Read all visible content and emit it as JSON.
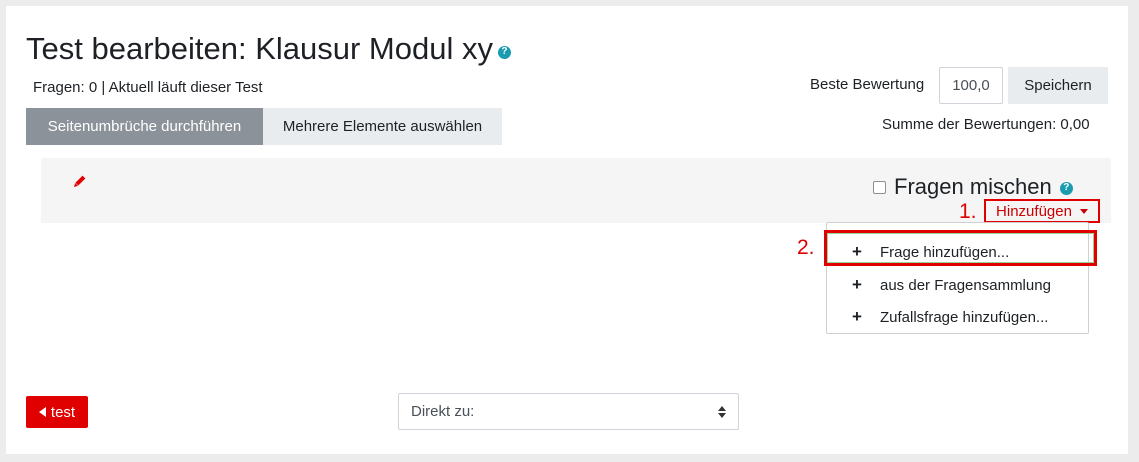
{
  "header": {
    "title": "Test bearbeiten: Klausur Modul xy",
    "help_icon": "?",
    "status": "Fragen: 0 | Aktuell läuft dieser Test"
  },
  "toolbar": {
    "repaginate_label": "Seitenumbrüche durchführen",
    "select_multiple_label": "Mehrere Elemente auswählen"
  },
  "grading": {
    "max_grade_label": "Beste Bewertung",
    "max_grade_value": "100,0",
    "save_label": "Speichern",
    "total_label": "Summe der Bewertungen: 0,00"
  },
  "section": {
    "edit_icon": "pencil-icon",
    "shuffle_label": "Fragen mischen",
    "shuffle_checked": false,
    "help_icon": "?"
  },
  "add_menu": {
    "step1": "1.",
    "step2": "2.",
    "toggle_label": "Hinzufügen",
    "items": [
      {
        "icon": "+",
        "label": "Frage hinzufügen..."
      },
      {
        "icon": "+",
        "label": "aus der Fragensammlung"
      },
      {
        "icon": "+",
        "label": "Zufallsfrage hinzufügen..."
      }
    ]
  },
  "footer": {
    "prev_label": "test",
    "jump_placeholder": "Direkt zu:"
  },
  "colors": {
    "accent_red": "#e00000",
    "help_teal": "#1a9bb0",
    "button_dark": "#8b9299",
    "button_light": "#e9ecef"
  }
}
